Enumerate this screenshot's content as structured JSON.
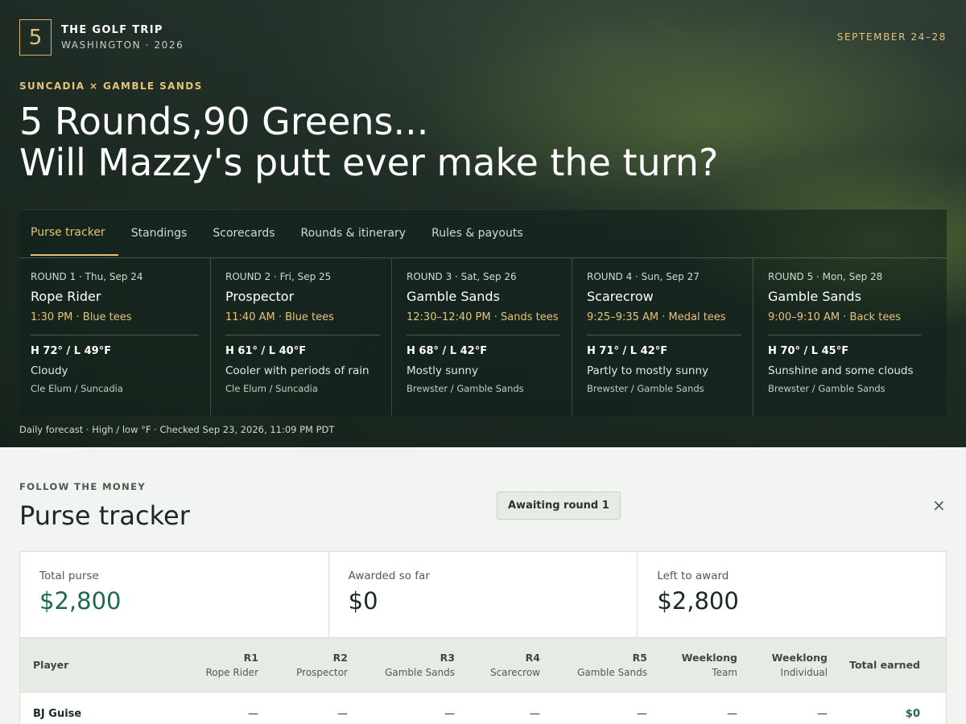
{
  "brand": {
    "mark": "5",
    "title": "THE GOLF TRIP",
    "subtitle": "WASHINGTON · 2026"
  },
  "dates": "SEPTEMBER 24–28",
  "hero": {
    "eyebrow": "SUNCADIA × GAMBLE SANDS",
    "line1": "5 Rounds,90 Greens...",
    "line2": "Will Mazzy's putt ever make the turn?"
  },
  "tabs": [
    {
      "label": "Purse tracker",
      "active": true
    },
    {
      "label": "Standings"
    },
    {
      "label": "Scorecards"
    },
    {
      "label": "Rounds & itinerary"
    },
    {
      "label": "Rules & payouts"
    }
  ],
  "rounds": [
    {
      "label": "ROUND 1 · Thu, Sep 24",
      "course": "Rope Rider",
      "time": "1:30 PM · Blue tees",
      "temp": "H 72° / L 49°F",
      "condition": "Cloudy",
      "location": "Cle Elum / Suncadia"
    },
    {
      "label": "ROUND 2 · Fri, Sep 25",
      "course": "Prospector",
      "time": "11:40 AM · Blue tees",
      "temp": "H 61° / L 40°F",
      "condition": "Cooler with periods of rain",
      "location": "Cle Elum / Suncadia"
    },
    {
      "label": "ROUND 3 · Sat, Sep 26",
      "course": "Gamble Sands",
      "time": "12:30–12:40 PM · Sands tees",
      "temp": "H 68° / L 42°F",
      "condition": "Mostly sunny",
      "location": "Brewster / Gamble Sands"
    },
    {
      "label": "ROUND 4 · Sun, Sep 27",
      "course": "Scarecrow",
      "time": "9:25–9:35 AM · Medal tees",
      "temp": "H 71° / L 42°F",
      "condition": "Partly to mostly sunny",
      "location": "Brewster / Gamble Sands"
    },
    {
      "label": "ROUND 5 · Mon, Sep 28",
      "course": "Gamble Sands",
      "time": "9:00–9:10 AM · Back tees",
      "temp": "H 70° / L 45°F",
      "condition": "Sunshine and some clouds",
      "location": "Brewster / Gamble Sands"
    }
  ],
  "forecast_note": "Daily forecast · High / low °F · Checked Sep 23, 2026, 11:09 PM PDT",
  "purse": {
    "eyebrow": "FOLLOW THE MONEY",
    "title": "Purse tracker",
    "badge": "Awaiting round 1",
    "close": "×",
    "stats": [
      {
        "label": "Total purse",
        "value": "$2,800"
      },
      {
        "label": "Awarded so far",
        "value": "$0"
      },
      {
        "label": "Left to award",
        "value": "$2,800"
      }
    ],
    "columns": {
      "player": "Player",
      "r1": {
        "top": "R1",
        "bottom": "Rope Rider"
      },
      "r2": {
        "top": "R2",
        "bottom": "Prospector"
      },
      "r3": {
        "top": "R3",
        "bottom": "Gamble Sands"
      },
      "r4": {
        "top": "R4",
        "bottom": "Scarecrow"
      },
      "r5": {
        "top": "R5",
        "bottom": "Gamble Sands"
      },
      "team": {
        "top": "Weeklong",
        "bottom": "Team"
      },
      "individual": {
        "top": "Weeklong",
        "bottom": "Individual"
      },
      "total": "Total earned"
    },
    "rows": [
      {
        "player": "BJ Guise",
        "r1": "—",
        "r2": "—",
        "r3": "—",
        "r4": "—",
        "r5": "—",
        "team": "—",
        "individual": "—",
        "total": "$0"
      }
    ]
  }
}
